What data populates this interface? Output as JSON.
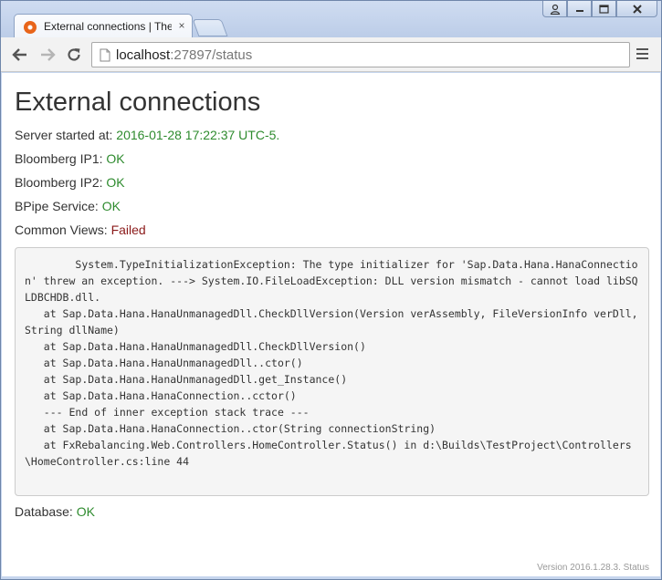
{
  "browser": {
    "tab_title": "External connections | The",
    "tab_close": "×",
    "url_host": "localhost",
    "url_rest": ":27897/status"
  },
  "page": {
    "title": "External connections",
    "server_started_label": "Server started at:",
    "server_started_value": "2016-01-28 17:22:37 UTC-5.",
    "bloomberg_ip1_label": "Bloomberg IP1:",
    "bloomberg_ip1_value": "OK",
    "bloomberg_ip2_label": "Bloomberg IP2:",
    "bloomberg_ip2_value": "OK",
    "bpipe_label": "BPipe Service:",
    "bpipe_value": "OK",
    "common_views_label": "Common Views:",
    "common_views_value": "Failed",
    "error_trace": "        System.TypeInitializationException: The type initializer for 'Sap.Data.Hana.HanaConnection' threw an exception. ---> System.IO.FileLoadException: DLL version mismatch - cannot load libSQLDBCHDB.dll.\n   at Sap.Data.Hana.HanaUnmanagedDll.CheckDllVersion(Version verAssembly, FileVersionInfo verDll, String dllName)\n   at Sap.Data.Hana.HanaUnmanagedDll.CheckDllVersion()\n   at Sap.Data.Hana.HanaUnmanagedDll..ctor()\n   at Sap.Data.Hana.HanaUnmanagedDll.get_Instance()\n   at Sap.Data.Hana.HanaConnection..cctor()\n   --- End of inner exception stack trace ---\n   at Sap.Data.Hana.HanaConnection..ctor(String connectionString)\n   at FxRebalancing.Web.Controllers.HomeController.Status() in d:\\Builds\\TestProject\\Controllers\\HomeController.cs:line 44",
    "database_label": "Database:",
    "database_value": "OK",
    "version": "Version 2016.1.28.3. Status"
  },
  "colors": {
    "ok": "#2e8b2e",
    "failed": "#8b1a1a"
  }
}
